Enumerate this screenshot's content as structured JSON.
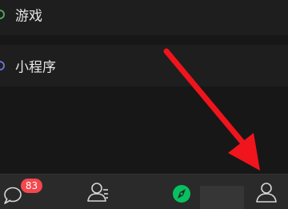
{
  "menu": {
    "items": [
      {
        "label": "游戏",
        "icon": "games-icon"
      },
      {
        "label": "小程序",
        "icon": "mini-program-icon"
      }
    ]
  },
  "tabbar": {
    "chats": {
      "icon": "chat-bubble-icon",
      "badge": "83"
    },
    "contacts": {
      "icon": "contacts-icon"
    },
    "discover": {
      "icon": "compass-icon",
      "active_color": "#07c160"
    },
    "me": {
      "icon": "person-icon"
    }
  },
  "annotation": {
    "icon": "red-arrow-icon",
    "color": "#f0141c"
  }
}
